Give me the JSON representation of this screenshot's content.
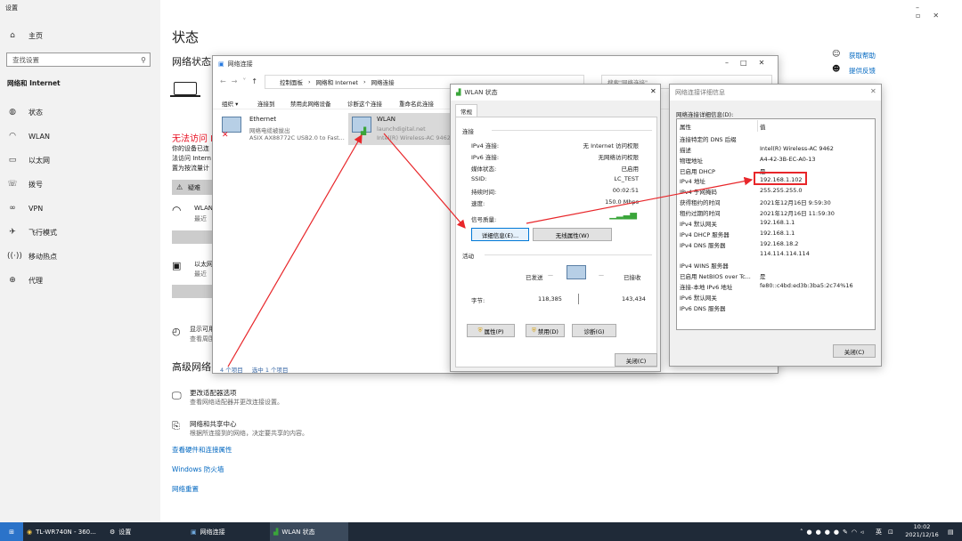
{
  "settings": {
    "app_title": "设置",
    "home": "主页",
    "search_placeholder": "查找设置",
    "section": "网络和 Internet",
    "nav": [
      "状态",
      "WLAN",
      "以太网",
      "拨号",
      "VPN",
      "飞行模式",
      "移动热点",
      "代理"
    ],
    "page_title": "状态",
    "network_status": "网络状态",
    "no_internet": "无法访问 I",
    "desc1": "你的设备已连",
    "desc2": "法访问 Intern",
    "desc3": "置为按流量计",
    "troubleshoot": "疑难",
    "wlan_title": "WLAN",
    "wlan_sub": "最近",
    "eth_title": "以太网",
    "eth_sub": "最近",
    "show_avail": "显示可用",
    "show_avail_sub": "查看周围",
    "advanced": "高级网络",
    "change_adapter": "更改适配器选项",
    "change_adapter_desc": "查看网络适配器并更改连接设置。",
    "sharing_center": "网络和共享中心",
    "sharing_center_desc": "根据所连接到的网络，决定要共享的内容。",
    "link_hw": "查看硬件和连接属性",
    "link_fw": "Windows 防火墙",
    "link_reset": "网络重置",
    "help": "获取帮助",
    "feedback": "提供反馈"
  },
  "netconn": {
    "title": "网络连接",
    "breadcrumb": [
      "控制面板",
      "网络和 Internet",
      "网络连接"
    ],
    "search_placeholder": "搜索\"网络连接\"",
    "toolbar": [
      "组织 ▾",
      "连接到",
      "禁用此网络设备",
      "诊断这个连接",
      "重命名此连接"
    ],
    "adapters": [
      {
        "name": "Ethernet",
        "status": "网络电缆被拔出",
        "device": "ASIX AX88772C USB2.0 to Fast..."
      },
      {
        "name": "WLAN",
        "status": "launchdigital.net",
        "device": "Intel(R) Wireless-AC 9462"
      }
    ],
    "count": "4 个项目",
    "selected": "选中 1 个项目"
  },
  "wlan_status": {
    "title": "WLAN 状态",
    "tab": "常规",
    "connection": "连接",
    "rows": [
      {
        "k": "IPv4 连接:",
        "v": "无 Internet 访问权限"
      },
      {
        "k": "IPv6 连接:",
        "v": "无网络访问权限"
      },
      {
        "k": "媒体状态:",
        "v": "已启用"
      },
      {
        "k": "SSID:",
        "v": "LC_TEST"
      },
      {
        "k": "持续时间:",
        "v": "00:02:51"
      },
      {
        "k": "速度:",
        "v": "150.0 Mbps"
      }
    ],
    "signal": "信号质量:",
    "details_btn": "详细信息(E)...",
    "wireless_btn": "无线属性(W)",
    "activity": "活动",
    "sent": "已发送",
    "received": "已接收",
    "bytes": "字节:",
    "bytes_sent": "118,385",
    "bytes_recv": "143,434",
    "props_btn": "属性(P)",
    "disable_btn": "禁用(D)",
    "diag_btn": "诊断(G)",
    "close_btn": "关闭(C)"
  },
  "details": {
    "title": "网络连接详细信息",
    "label": "网络连接详细信息(D):",
    "col_prop": "属性",
    "col_val": "值",
    "rows": [
      {
        "k": "连接特定的 DNS 后缀",
        "v": ""
      },
      {
        "k": "描述",
        "v": "Intel(R) Wireless-AC 9462"
      },
      {
        "k": "物理地址",
        "v": "A4-42-3B-EC-A0-13"
      },
      {
        "k": "已启用 DHCP",
        "v": "是"
      },
      {
        "k": "IPv4 地址",
        "v": "192.168.1.102"
      },
      {
        "k": "IPv4 子网掩码",
        "v": "255.255.255.0"
      },
      {
        "k": "获得租约的时间",
        "v": "2021年12月16日 9:59:30"
      },
      {
        "k": "租约过期的时间",
        "v": "2021年12月16日 11:59:30"
      },
      {
        "k": "IPv4 默认网关",
        "v": "192.168.1.1"
      },
      {
        "k": "IPv4 DHCP 服务器",
        "v": "192.168.1.1"
      },
      {
        "k": "IPv4 DNS 服务器",
        "v": "192.168.18.2"
      },
      {
        "k": "",
        "v": "114.114.114.114"
      },
      {
        "k": "IPv4 WINS 服务器",
        "v": ""
      },
      {
        "k": "已启用 NetBIOS over Tc...",
        "v": "是"
      },
      {
        "k": "连接-本地 IPv6 地址",
        "v": "fe80::c4bd:ed3b:3ba5:2c74%16"
      },
      {
        "k": "IPv6 默认网关",
        "v": ""
      },
      {
        "k": "IPv6 DNS 服务器",
        "v": ""
      }
    ],
    "close_btn": "关闭(C)"
  },
  "taskbar": {
    "items": [
      "TL-WR740N - 360...",
      "设置",
      "网络连接",
      "WLAN 状态"
    ],
    "ime": "英",
    "time": "10:02",
    "date": "2021/12/16"
  },
  "colors": {
    "accent": "#0078d7",
    "error": "#e81123",
    "annotation": "#e8262a",
    "taskbar": "#1f2a38"
  }
}
